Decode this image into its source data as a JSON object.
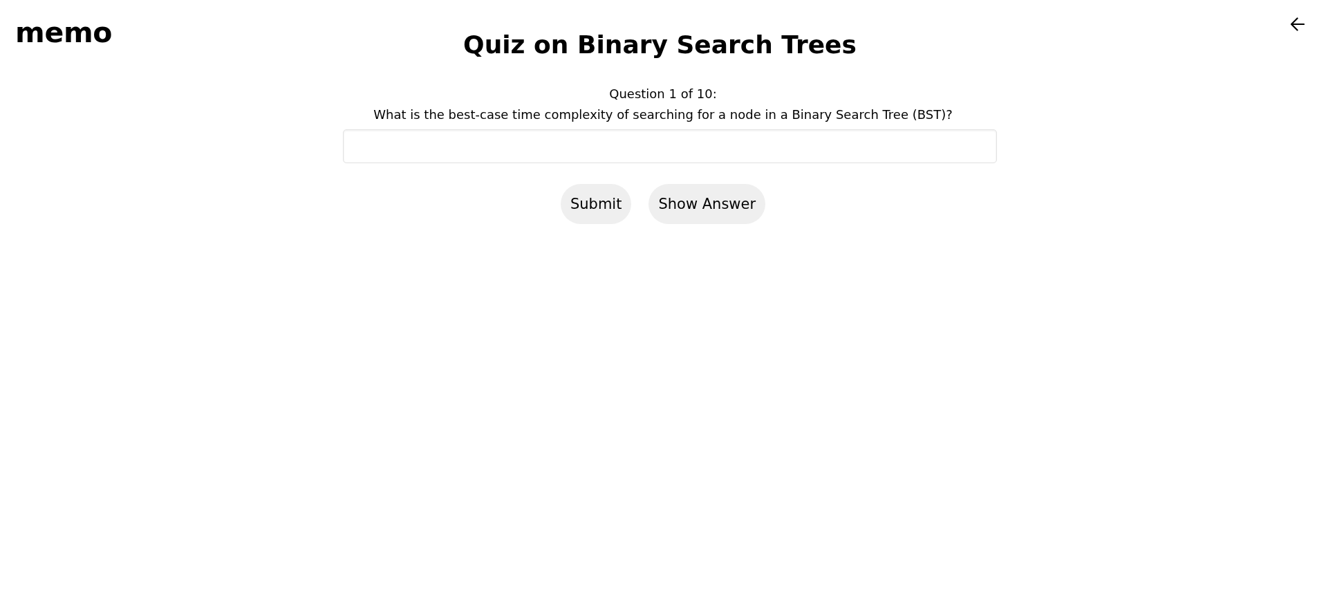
{
  "logo": "memo",
  "title": "Quiz on Binary Search Trees",
  "question": {
    "counter": "Question 1 of 10:",
    "text": "What is the best-case time complexity of searching for a node in a Binary Search Tree (BST)?"
  },
  "buttons": [
    "Submit",
    "Show Answer"
  ]
}
